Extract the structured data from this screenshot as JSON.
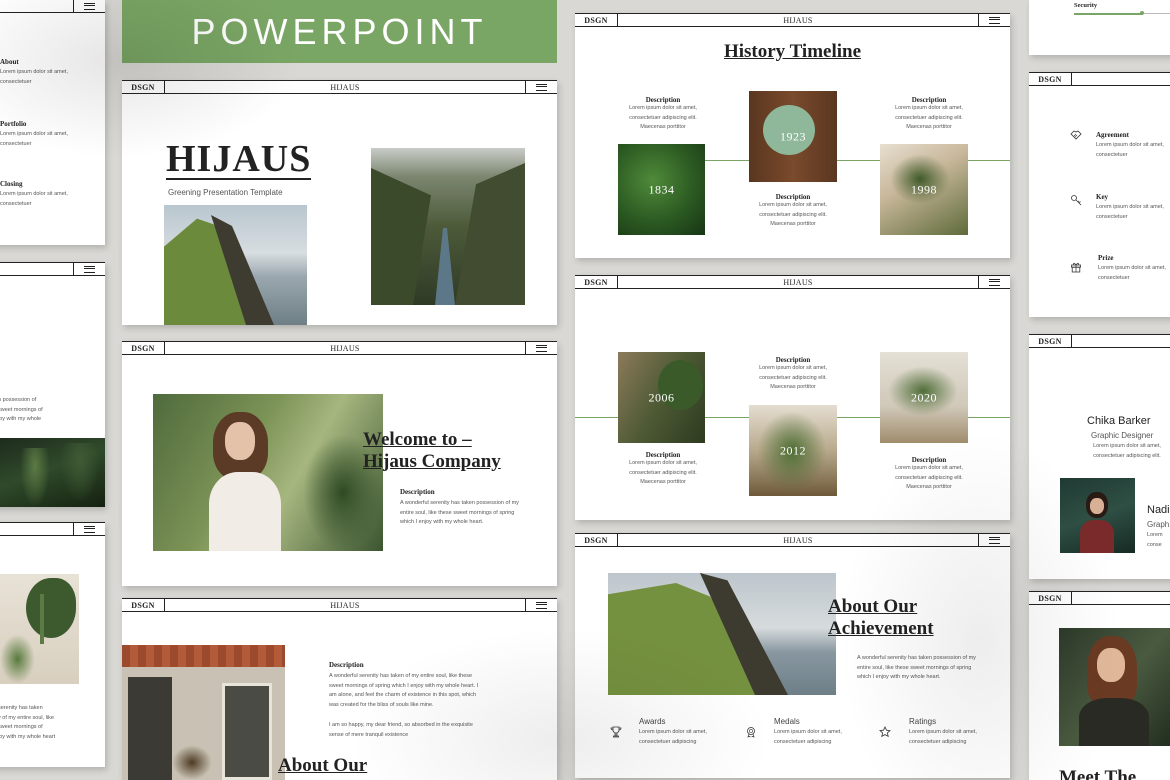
{
  "banner": {
    "title": "POWERPOINT",
    "color": "#7aa665"
  },
  "bar": {
    "dsgn": "DSGN",
    "brand": "HIJAUS"
  },
  "left_col": {
    "s1": [
      {
        "title": "About",
        "text": "Lorem ipsum dolor sit amet, consectetuer"
      },
      {
        "title": "Portfolio",
        "text": "Lorem ipsum dolor sit amet, consectetuer"
      },
      {
        "title": "Closing",
        "text": "Lorem ipsum dolor sit amet, consectetuer"
      }
    ],
    "s2": {
      "text": "n possession of\nsweet mornings of\njoy with my whole"
    },
    "s3": {
      "text": "serenity has taken\ny of my entire soul, like\nsweet mornings of\njoy with my whole heart"
    }
  },
  "cover": {
    "title": "HIJAUS",
    "subtitle": "Greening Presentation Template"
  },
  "welcome": {
    "title_line1": "Welcome to –",
    "title_line2": "Hijaus Company",
    "desc_title": "Description",
    "desc_text": "A wonderful serenity has taken possession of my entire soul, like these sweet mornings of spring which I enjoy with my whole heart."
  },
  "about": {
    "desc_title": "Description",
    "para1": "A wonderful serenity has taken of my entire soul, like these sweet mornings of spring which I enjoy with my whole heart. I am alone, and feel the charm of existence in this spot, which was created for the bliss of souls like mine.",
    "para2": "I am so happy, my dear friend, so absorbed in the exquisite sense of mere tranquil existence",
    "title": "About Our"
  },
  "history": {
    "title": "History Timeline",
    "desc_title": "Description",
    "desc_text": "Lorem ipsum dolor sit amet, consectetuer adipiscing elit. Maecenas porttitor",
    "years": [
      "1834",
      "1923",
      "1998"
    ]
  },
  "timeline2": {
    "desc_title": "Description",
    "desc_text": "Lorem ipsum dolor sit amet, consectetuer adipiscing elit. Maecenas porttitor",
    "years": [
      "2006",
      "2012",
      "2020"
    ]
  },
  "achievement": {
    "title_line1": "About Our",
    "title_line2": "Achievement",
    "text": "A wonderful serenity has taken possession of my entire soul, like these sweet mornings of spring which I enjoy with my whole heart.",
    "items": [
      {
        "label": "Awards",
        "icon": "trophy-icon",
        "text": "Lorem ipsum dolor sit amet, consectetuer adipiscing"
      },
      {
        "label": "Medals",
        "icon": "medal-icon",
        "text": "Lorem ipsum dolor sit amet, consectetuer adipiscing"
      },
      {
        "label": "Ratings",
        "icon": "star-icon",
        "text": "Lorem ipsum dolor sit amet, consectetuer adipiscing"
      }
    ]
  },
  "right_col": {
    "security": "Security",
    "items": [
      {
        "title": "Agreement",
        "icon": "handshake-icon",
        "text": "Lorem ipsum dolor sit amet, consectetuer"
      },
      {
        "title": "Key",
        "icon": "key-icon",
        "text": "Lorem ipsum dolor sit amet, consectetuer"
      },
      {
        "title": "Prize",
        "icon": "gift-icon",
        "text": "Lorem ipsum dolor sit amet, consectetuer"
      }
    ],
    "team": {
      "name1": "Chika Barker",
      "role1": "Graphic Designer",
      "text1": "Lorem ipsum dolor sit amet, consectetuer adipiscing elit.",
      "name2": "Nadi",
      "role2": "Graph",
      "text2": "Lorem\nconse"
    },
    "meet": "Meet The"
  }
}
